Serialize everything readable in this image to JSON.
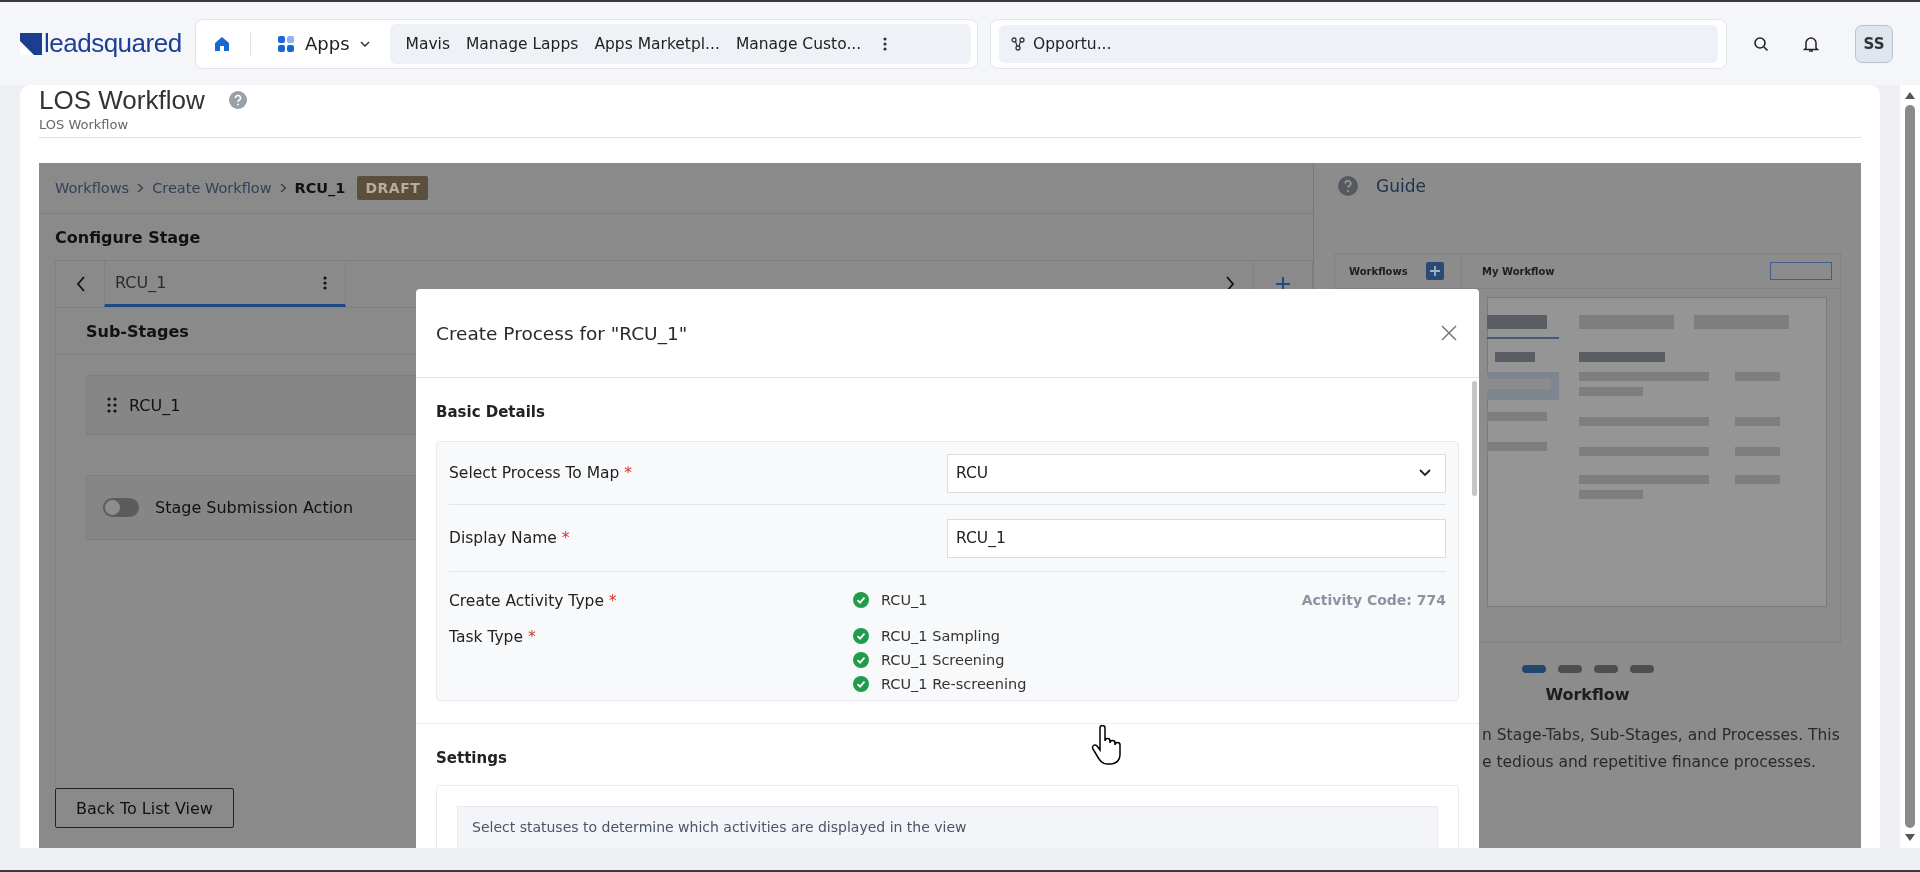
{
  "topbar": {
    "logo": "leadsquared",
    "apps_menu": "Apps",
    "nav_items": [
      "Mavis",
      "Manage Lapps",
      "Apps Marketpl...",
      "Manage Custo..."
    ],
    "search": {
      "value": "Opportu..."
    },
    "avatar": "SS"
  },
  "page": {
    "title": "LOS Workflow",
    "subtitle": "LOS Workflow"
  },
  "breadcrumbs": [
    {
      "label": "Workflows",
      "current": false
    },
    {
      "label": "Create Workflow",
      "current": false
    },
    {
      "label": "RCU_1",
      "current": true
    }
  ],
  "status_badge": "DRAFT",
  "configure_stage": {
    "title": "Configure Stage",
    "tabs": [
      {
        "label": "RCU_1",
        "selected": true
      }
    ],
    "sub_stages_title": "Sub-Stages",
    "sub_stages": [
      {
        "label": "RCU_1"
      }
    ],
    "submission_action": {
      "label": "Stage Submission Action",
      "on": false
    }
  },
  "back_button": "Back To List View",
  "guide": {
    "title": "Guide",
    "preview": {
      "sidebar_title": "Workflows",
      "title": "My Workflow"
    },
    "slides": [
      {
        "selected": true
      },
      {
        "selected": false
      },
      {
        "selected": false
      },
      {
        "selected": false
      }
    ],
    "slide_title": "Workflow",
    "description": [
      "n Stage-Tabs, Sub-Stages, and Processes. This",
      "e tedious and repetitive finance processes."
    ]
  },
  "modal": {
    "title": "Create Process for \"RCU_1\"",
    "basic_details": {
      "title": "Basic Details",
      "fields": [
        {
          "kind": "select",
          "label": "Select Process To Map",
          "marker": "*",
          "value": "RCU"
        },
        {
          "kind": "text",
          "label": "Display Name",
          "marker": "*",
          "value": "RCU_1"
        },
        {
          "kind": "status",
          "label": "Create Activity Type",
          "marker": "*",
          "items": [
            "RCU_1"
          ],
          "note": "Activity Code: 774"
        },
        {
          "kind": "status",
          "label": "Task Type",
          "marker": "*",
          "items": [
            "RCU_1 Sampling",
            "RCU_1 Screening",
            "RCU_1 Re-screening"
          ]
        }
      ]
    },
    "settings": {
      "title": "Settings",
      "hint": "Select statuses to determine which activities are displayed in the view"
    }
  }
}
